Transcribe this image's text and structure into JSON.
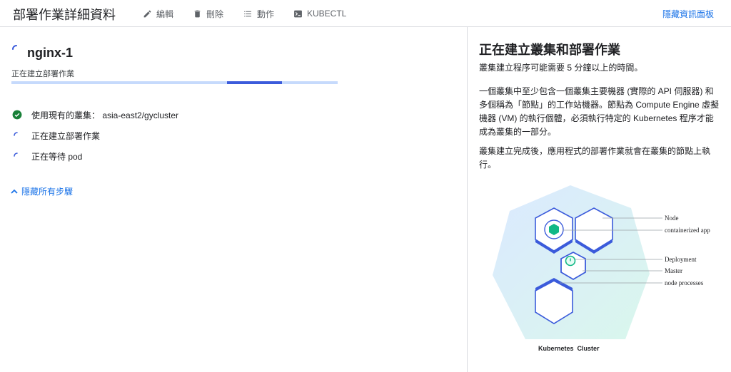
{
  "header": {
    "title": "部署作業詳細資料",
    "actions": [
      {
        "label": "編輯",
        "icon": "pencil-icon"
      },
      {
        "label": "刪除",
        "icon": "trash-icon"
      },
      {
        "label": "動作",
        "icon": "list-icon"
      },
      {
        "label": "KUBECTL",
        "icon": "terminal-icon"
      }
    ],
    "hide_panel_label": "隱藏資訊面板"
  },
  "deployment": {
    "name": "nginx-1",
    "status": "正在建立部署作業",
    "progress": 0.83
  },
  "steps": [
    {
      "label": "使用現有的叢集： asia-east2/gycluster",
      "state": "done"
    },
    {
      "label": "正在建立部署作業",
      "state": "in-progress"
    },
    {
      "label": "正在等待 pod",
      "state": "in-progress"
    }
  ],
  "hide_steps_label": "隱藏所有步驟",
  "info": {
    "title": "正在建立叢集和部署作業",
    "paragraphs": [
      "叢集建立程序可能需要 5 分鐘以上的時間。",
      "一個叢集中至少包含一個叢集主要機器 (實際的 API 伺服器) 和多個稱為「節點」的工作站機器。節點為 Compute Engine 虛擬機器 (VM) 的執行個體，必須執行特定的 Kubernetes 程序才能成為叢集的一部分。",
      "叢集建立完成後，應用程式的部署作業就會在叢集的節點上執行。"
    ],
    "diagram": {
      "labels": [
        "Node",
        "containerized app",
        "Deployment",
        "Master",
        "node processes"
      ],
      "caption": "Kubernetes  Cluster",
      "colors": {
        "outline": "#3b5bdb",
        "app": "#12b886",
        "bg_light": "#e3f0ff",
        "bg_mint": "#dff7ef"
      }
    }
  }
}
